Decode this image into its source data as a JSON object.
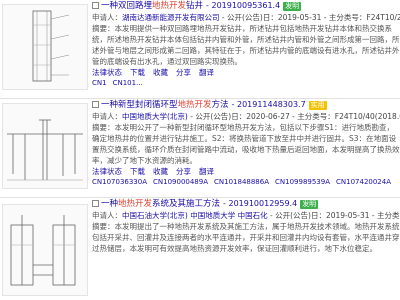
{
  "results": [
    {
      "prefix": "【一种】",
      "title": "【一种】双回路埋地热开发钻井",
      "title_plain": "一种双回路埋",
      "title_hl": "地热开发",
      "title_tail": "钻井",
      "pub_no": "- 201910095361.4",
      "badge": "发明",
      "applicant_label": "申请人：",
      "applicant": "湖南达通新能源开发有限公司",
      "date_info": "- 公开(公告)日：2019-05-31 - 主分类号：F24T10/20(2018.01)",
      "abstract": "摘要：本发明提供一种双回路埋地热开发钻井，所述钻井包括地热开发钻井本体和热交换系统，所述地热开发钻井本体包括钻井内管和外管，所述钻井内管和外管之间形成第一回路，所述外管与地层之间形成第二回路，其特征在于，所述钻井内管的底端设有进水孔，所述钻井外管的底端设有出水孔，通过双回路实现换热。",
      "actions": [
        "法律状态",
        "下载",
        "收藏",
        "分享",
        "翻译"
      ],
      "refs": [
        "CN1",
        "CN101..."
      ]
    },
    {
      "title_plain": "一种新型封闭循环型",
      "title_hl": "地热开发",
      "title_tail": "方法",
      "pub_no": "- 201911448303.7",
      "badge": "实用",
      "applicant_label": "申请人：",
      "applicant": "中国地质大学(北京)",
      "date_info": "- 公开(公告)日：2020-06-27 - 主分类号：F24T10/40(2018.01)",
      "abstract": "摘要：本发明公开了一种新型封闭循环型地热开发方法，包括以下步骤S1：进行地质勘查，确定地热井的位置并进行钻井施工。S2：将换热管道下放至井中并进行固井。S3：在地面设置热交换系统，循环介质在封闭管路中流动，吸收地下热量后返回地面，本发明提高了换热效率，减少了地下水资源的消耗。",
      "actions": [
        "法律状态",
        "下载",
        "收藏",
        "分享",
        "翻译"
      ],
      "refs": [
        "CN107036330A",
        "CN109000489A",
        "CN101848886A",
        "CN109989539A",
        "CN107420024A"
      ]
    },
    {
      "title_plain": "一种",
      "title_hl": "地热开发",
      "title_tail": "系统及其施工方法",
      "pub_no": "- 201910012959.4",
      "badge": "发明",
      "applicant_label": "申请人：",
      "applicant": "中国石油大学(北京) 中国地质大学 中国石化",
      "date_info": "- 公开(公告)日：2019-05-31 - 主分类号：E21B",
      "abstract": "摘要：本发明提出了一种地热开发系统及其施工方法，属于地热开发技术领域。地热开发系统包括开采井、回灌井及连接两者的水平连通井，开采井和回灌井内均设有套管，水平连通井穿过热储层，本发明可有效提高地热资源开发效率，保证回灌顺利进行，地下水位稳定。",
      "actions": [
        "法律状态",
        "下载",
        "收藏",
        "分享",
        "翻译"
      ],
      "refs": []
    }
  ]
}
